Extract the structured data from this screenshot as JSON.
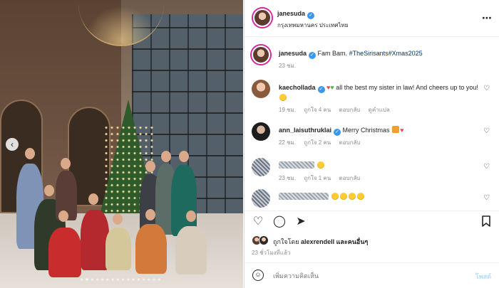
{
  "post": {
    "author": "janesuda",
    "location": "กรุงเทพมหานคร ประเทศไทย",
    "more_icon": "ellipsis-icon"
  },
  "caption": {
    "user": "janesuda",
    "text": "Fam Bam.",
    "hashtags": [
      "#TheSirisants",
      "#Xmas2025"
    ],
    "time": "23 ชม."
  },
  "comments": [
    {
      "user": "kaechollada",
      "text": "all the best my sister in law! And cheers up to you!",
      "time": "19 ชม.",
      "likes": "ถูกใจ 4 คน",
      "reply": "ตอบกลับ",
      "translate": "ดูคำแปล"
    },
    {
      "user": "ann_laisuthruklai",
      "text": "Merry Christmas",
      "time": "22 ชม.",
      "likes": "ถูกใจ 2 คน",
      "reply": "ตอบกลับ"
    },
    {
      "user": "",
      "time": "23 ชม.",
      "likes": "ถูกใจ 1 คน",
      "reply": "ตอบกลับ"
    },
    {
      "user": ""
    }
  ],
  "likes": {
    "text_prefix": "ถูกใจโดย",
    "user": "alexrendell",
    "text_suffix": "และคนอื่นๆ"
  },
  "posted_ago": "23 ชั่วโมงที่แล้ว",
  "composer": {
    "placeholder": "เพิ่มความคิดเห็น",
    "post_label": "โพสต์"
  },
  "colors": {
    "link": "#00376b",
    "verified": "#3897f0",
    "heart": "#ed4956",
    "post_disabled": "#b2dffc"
  }
}
